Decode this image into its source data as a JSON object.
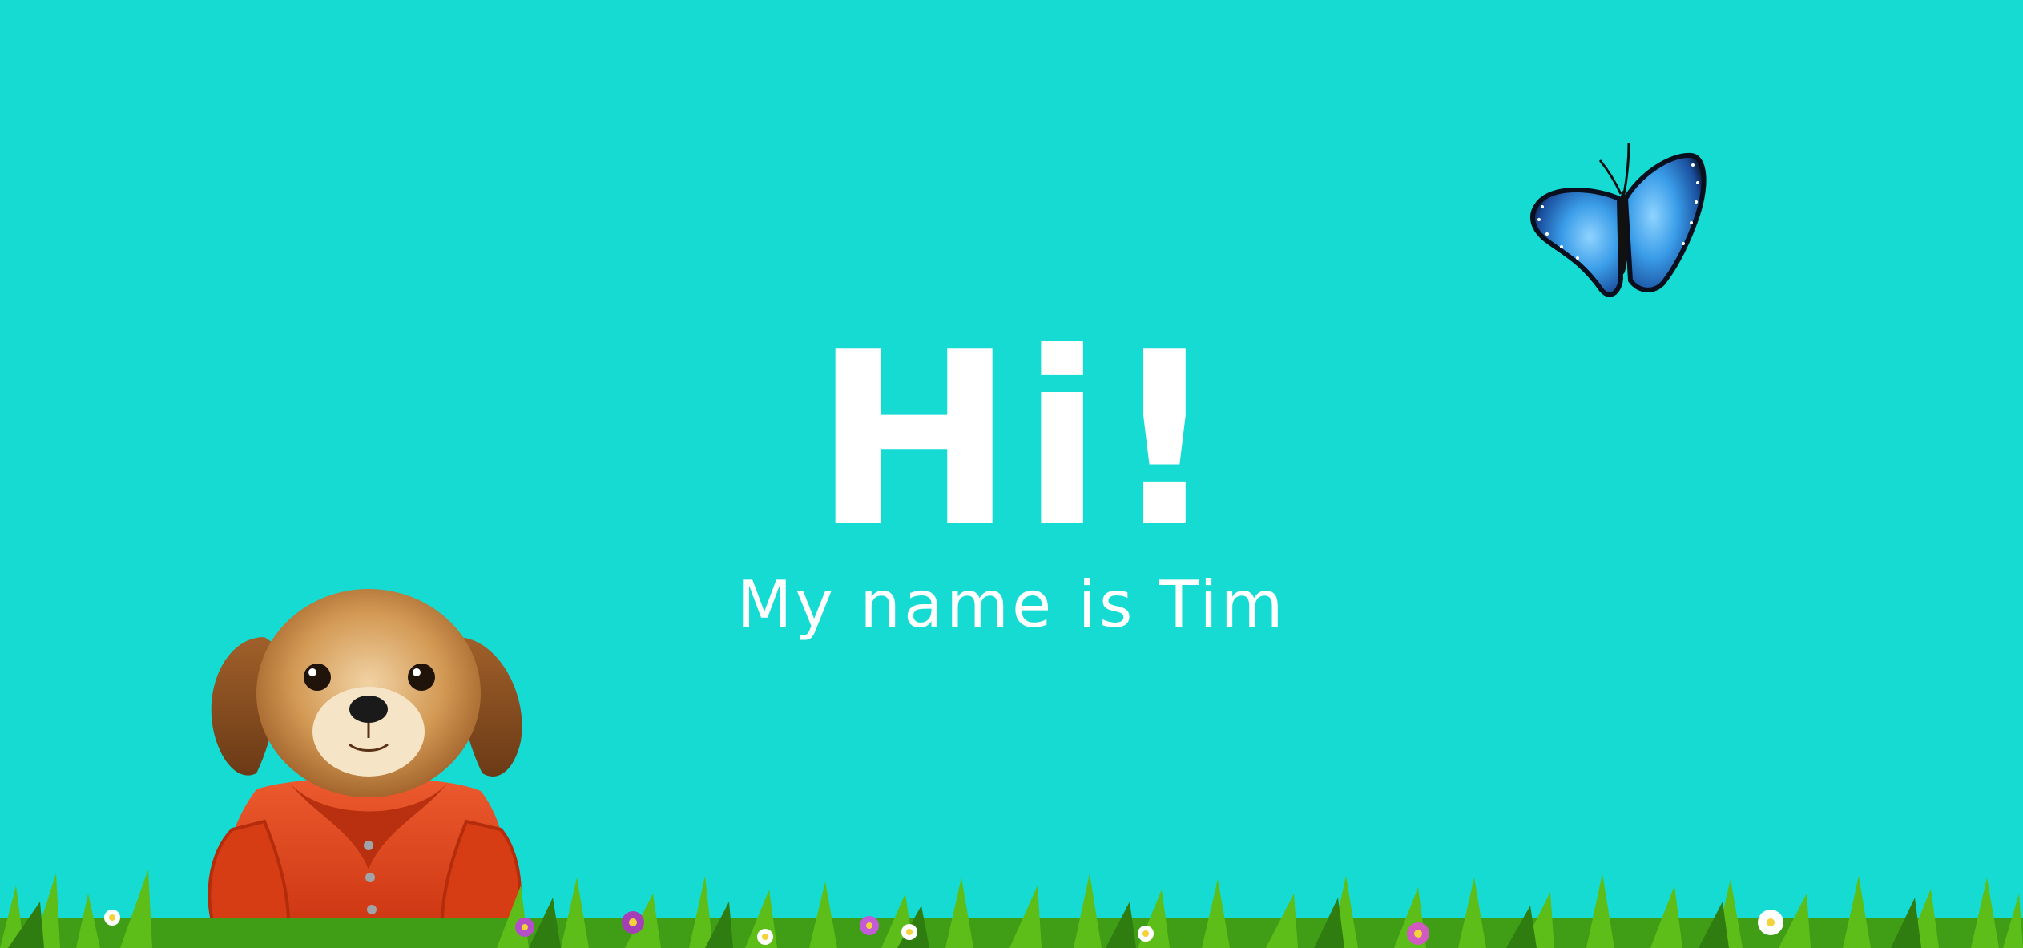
{
  "greeting": {
    "title": "Hi!",
    "subtitle": "My name is Tim"
  },
  "colors": {
    "background": "#16DBD3",
    "text": "#FFFFFF",
    "butterfly": "#2E8FE0",
    "puppy_fur": "#C9843E",
    "puppy_shirt": "#E0411E",
    "grass": "#5DBE1A"
  },
  "illustrations": {
    "butterfly": "blue-morpho-butterfly",
    "puppy": "puppy-in-red-shirt",
    "grass": "grass-with-flowers"
  }
}
